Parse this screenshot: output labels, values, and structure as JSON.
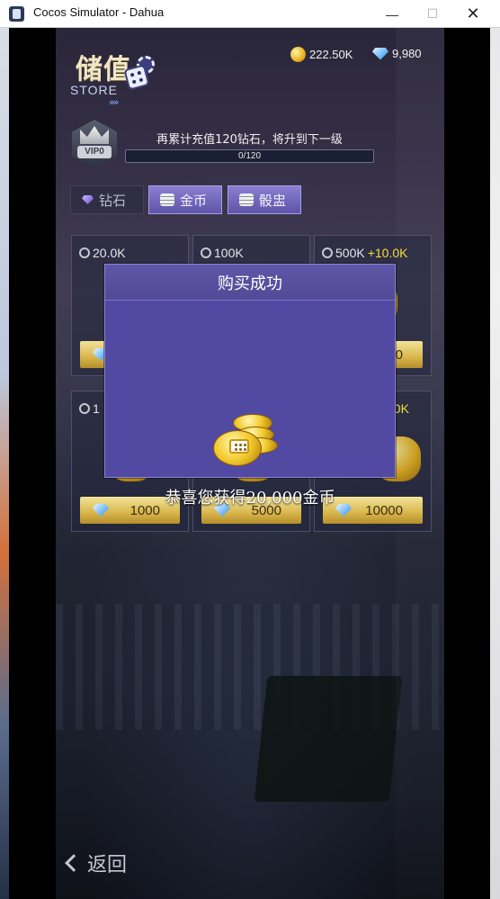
{
  "window": {
    "title": "Cocos Simulator - Dahua",
    "minimize_glyph": "—",
    "maximize_glyph": "☐",
    "close_glyph": "✕"
  },
  "header": {
    "logo_cn": "储值",
    "logo_en": "STORE",
    "gold_balance": "222.50K",
    "gem_balance": "9,980"
  },
  "vip": {
    "level": "VIP0",
    "progress_text": "再累计充值120钻石，将升到下一级",
    "progress_value": "0/120",
    "progress_fraction": 0
  },
  "tabs": [
    {
      "label": "钻石",
      "icon": "diamond-icon",
      "active": false
    },
    {
      "label": "金币",
      "icon": "coin-stack-icon",
      "active": true
    },
    {
      "label": "骰盅",
      "icon": "coin-stack-icon",
      "active": true
    }
  ],
  "cards": [
    {
      "amount": "20.0K",
      "bonus": "",
      "price": ""
    },
    {
      "amount": "100K",
      "bonus": "",
      "price": ""
    },
    {
      "amount": "500K",
      "bonus": "+10.0K",
      "price": "0"
    },
    {
      "amount": "1",
      "bonus": "",
      "price": "1000"
    },
    {
      "amount": "",
      "bonus": "",
      "price": "5000"
    },
    {
      "amount": "",
      "bonus": "00K",
      "price": "10000"
    }
  ],
  "modal": {
    "title": "购买成功",
    "message": "恭喜您获得20,000金币"
  },
  "footer": {
    "back_label": "返回"
  },
  "colors": {
    "modal_bg": "#5249a3",
    "tab_active": "#7a70c8",
    "buy_button": "#d8b64c",
    "bonus_text": "#f4dc3a"
  }
}
